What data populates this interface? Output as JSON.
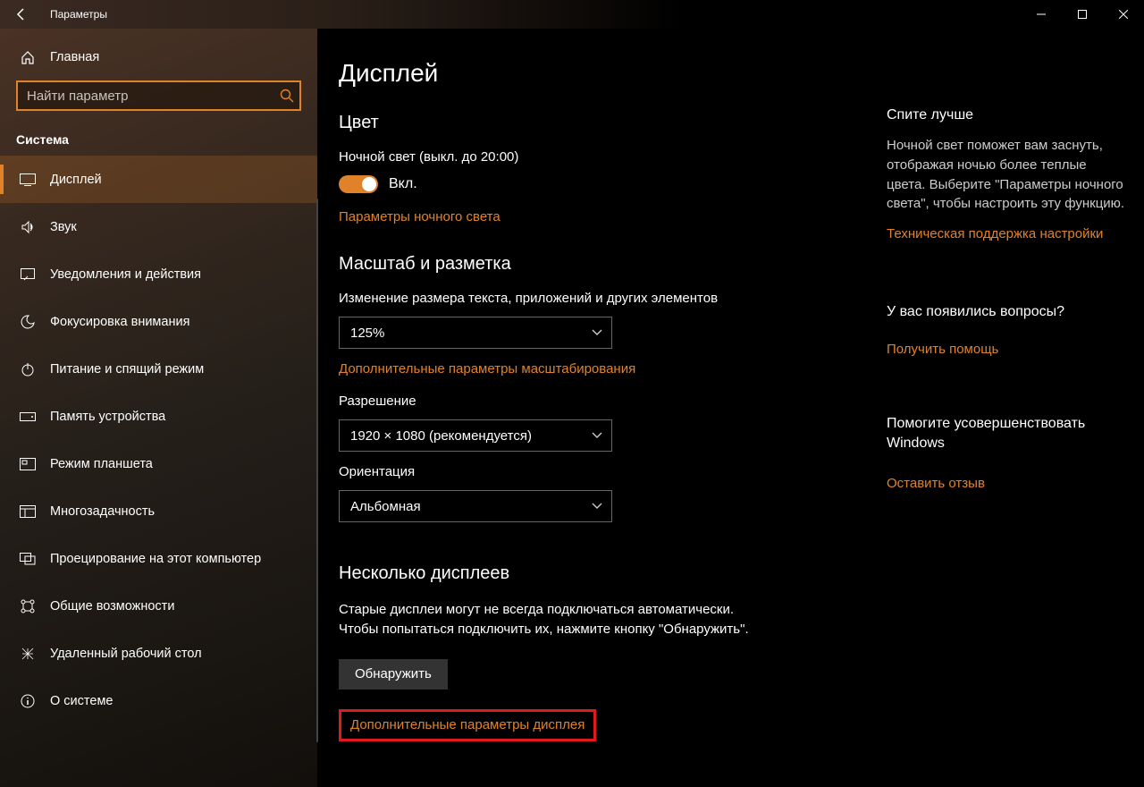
{
  "window": {
    "title": "Параметры"
  },
  "sidebar": {
    "home": "Главная",
    "search_placeholder": "Найти параметр",
    "section": "Система",
    "items": [
      {
        "label": "Дисплей"
      },
      {
        "label": "Звук"
      },
      {
        "label": "Уведомления и действия"
      },
      {
        "label": "Фокусировка внимания"
      },
      {
        "label": "Питание и спящий режим"
      },
      {
        "label": "Память устройства"
      },
      {
        "label": "Режим планшета"
      },
      {
        "label": "Многозадачность"
      },
      {
        "label": "Проецирование на этот компьютер"
      },
      {
        "label": "Общие возможности"
      },
      {
        "label": "Удаленный рабочий стол"
      },
      {
        "label": "О системе"
      }
    ]
  },
  "main": {
    "heading": "Дисплей",
    "color": {
      "title": "Цвет",
      "night_light_label": "Ночной свет (выкл. до 20:00)",
      "toggle_state": "Вкл.",
      "night_light_settings_link": "Параметры ночного света"
    },
    "scale": {
      "title": "Масштаб и разметка",
      "resize_label": "Изменение размера текста, приложений и других элементов",
      "scale_value": "125%",
      "advanced_scale_link": "Дополнительные параметры масштабирования",
      "resolution_label": "Разрешение",
      "resolution_value": "1920 × 1080 (рекомендуется)",
      "orientation_label": "Ориентация",
      "orientation_value": "Альбомная"
    },
    "multi": {
      "title": "Несколько дисплеев",
      "desc": "Старые дисплеи могут не всегда подключаться автоматически. Чтобы попытаться подключить их, нажмите кнопку \"Обнаружить\".",
      "detect_btn": "Обнаружить",
      "advanced_link": "Дополнительные параметры дисплея"
    }
  },
  "aside": {
    "sleep_title": "Спите лучше",
    "sleep_body": "Ночной свет поможет вам заснуть, отображая ночью более теплые цвета. Выберите \"Параметры ночного света\", чтобы настроить эту функцию.",
    "support_link": "Техническая поддержка настройки",
    "questions_title": "У вас появились вопросы?",
    "help_link": "Получить помощь",
    "improve_title": "Помогите усовершенствовать Windows",
    "feedback_link": "Оставить отзыв"
  }
}
